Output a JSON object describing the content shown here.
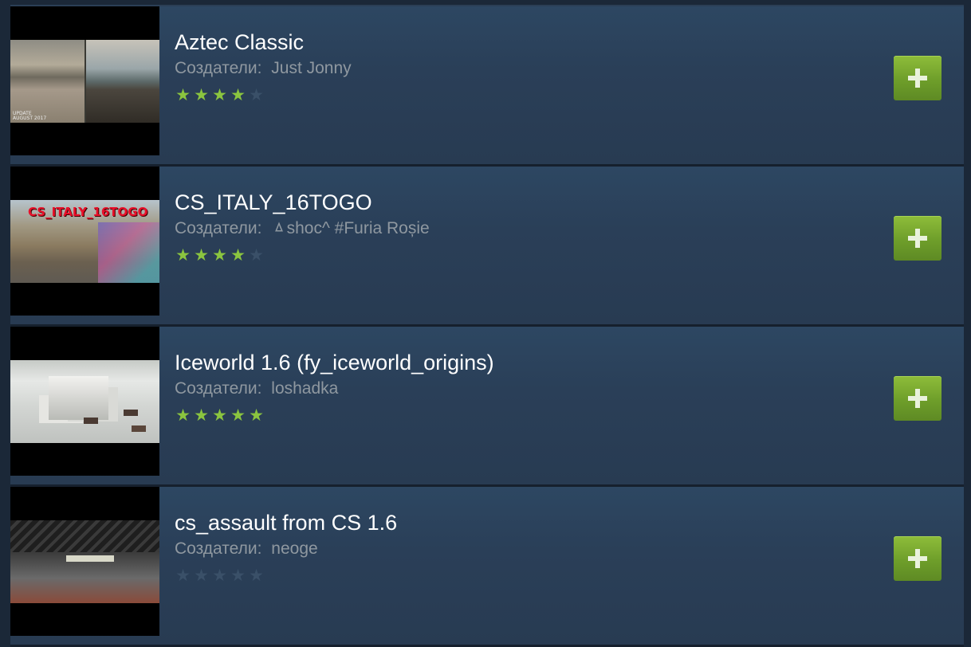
{
  "creators_prefix": "Создатели:",
  "items": [
    {
      "title": "Aztec Classic",
      "creators": "Just Jonny",
      "stars": 4,
      "thumb_text": "UPDATE AUGUST 2017",
      "add_icon": "plus-icon"
    },
    {
      "title": "CS_ITALY_16TOGO",
      "creators": "ㅿshoc^ #Furia Roșie",
      "stars": 4,
      "thumb_text": "CS_ITALY_16TOGO",
      "add_icon": "plus-icon"
    },
    {
      "title": "Iceworld 1.6 (fy_iceworld_origins)",
      "creators": "loshadka",
      "stars": 5,
      "thumb_text": "",
      "add_icon": "plus-icon"
    },
    {
      "title": "cs_assault from CS 1.6",
      "creators": "neoge",
      "stars": 0,
      "thumb_text": "",
      "add_icon": "plus-icon"
    }
  ],
  "colors": {
    "background": "#1b2838",
    "item_background": "#2a3f58",
    "title": "#ffffff",
    "subtext": "#8f98a0",
    "star": "#8bc53f",
    "add_button": "#7aa834"
  }
}
